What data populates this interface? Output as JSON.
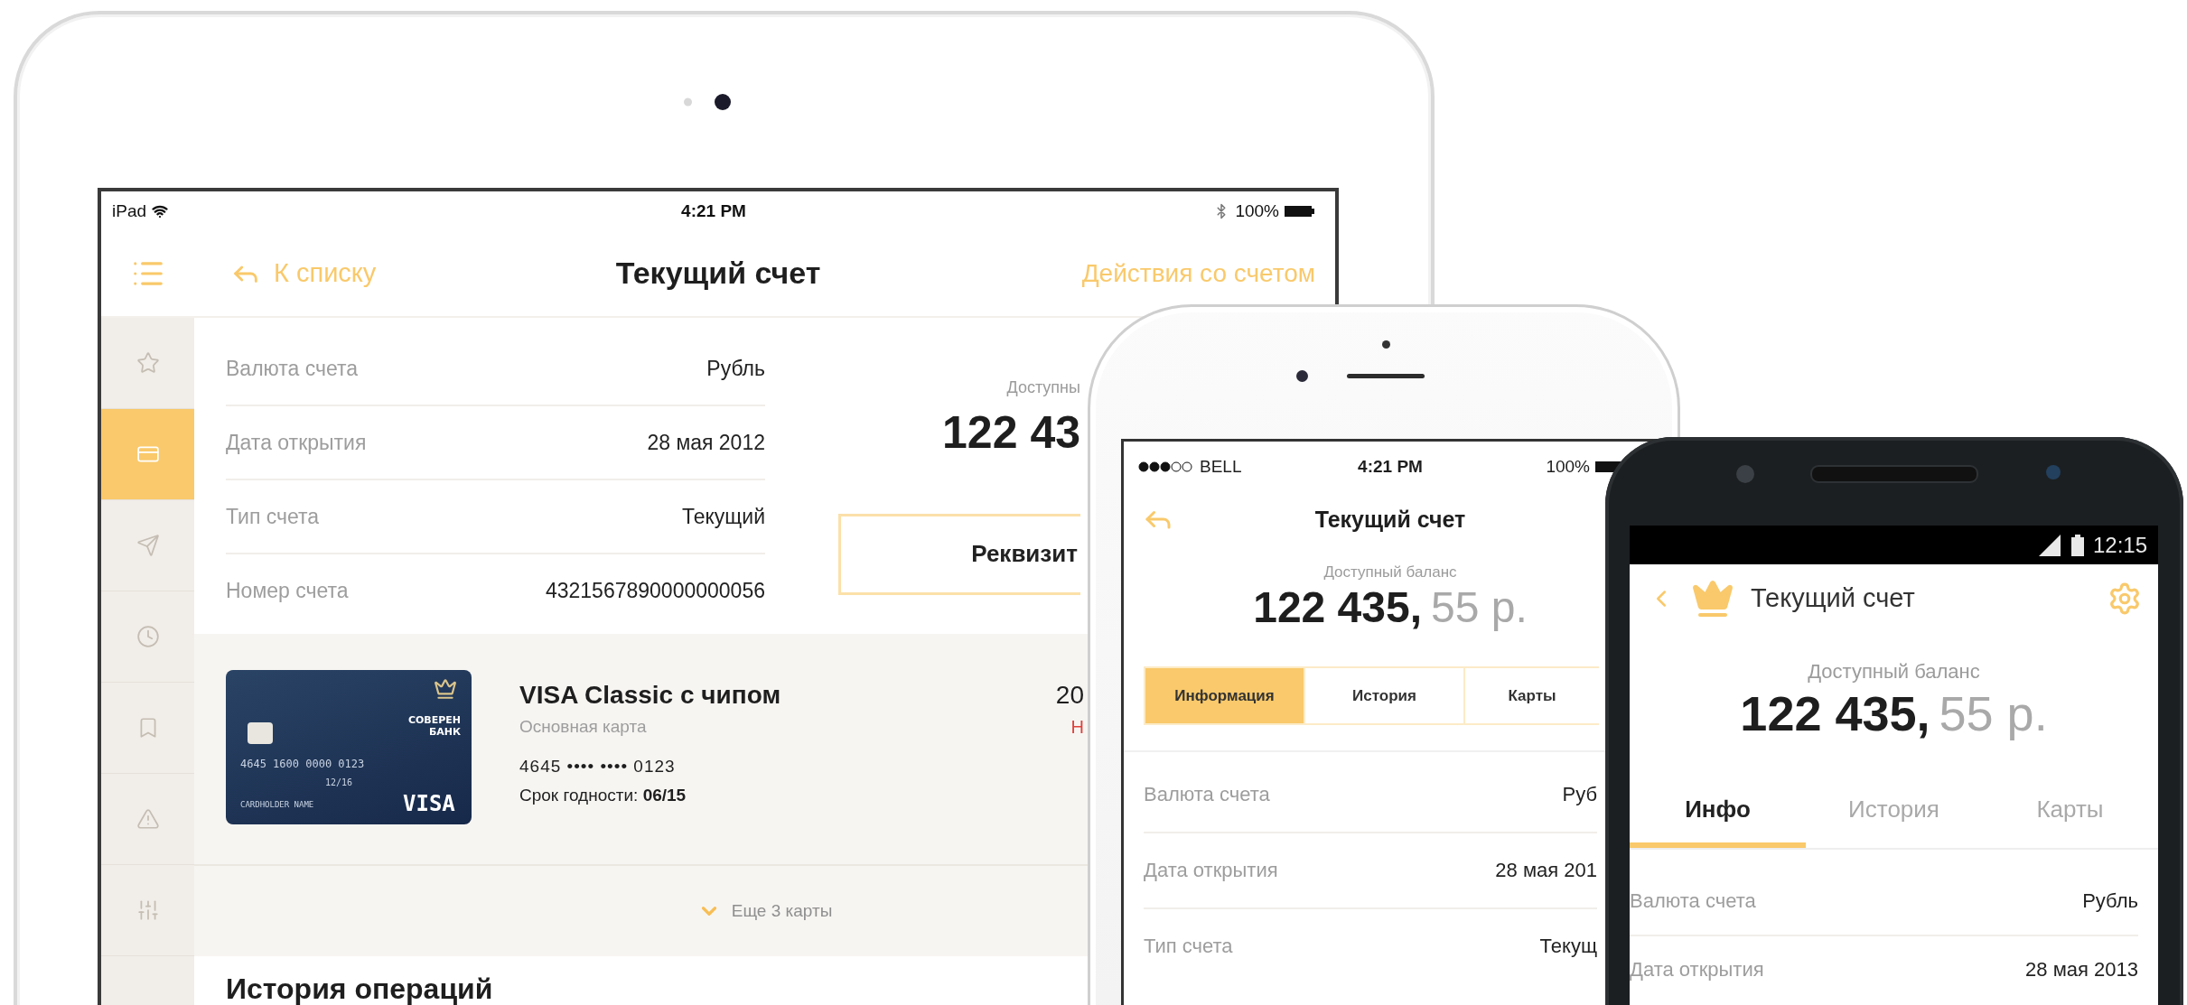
{
  "tablet": {
    "status_bar": {
      "device": "iPad",
      "time": "4:21 PM",
      "battery": "100%"
    },
    "nav": {
      "back": "К списку",
      "title": "Текущий счет",
      "actions": "Действия со счетом"
    },
    "sidebar": [
      {
        "kind": "star",
        "selected": false
      },
      {
        "kind": "card",
        "selected": true
      },
      {
        "kind": "send",
        "selected": false
      },
      {
        "kind": "clock",
        "selected": false
      },
      {
        "kind": "bookmark",
        "selected": false
      },
      {
        "kind": "warning",
        "selected": false
      },
      {
        "kind": "sliders",
        "selected": false
      }
    ],
    "info_rows": [
      {
        "label": "Валюта счета",
        "value": "Рубль"
      },
      {
        "label": "Дата открытия",
        "value": "28 мая 2012"
      },
      {
        "label": "Тип счета",
        "value": "Текущий"
      },
      {
        "label": "Номер счета",
        "value": "4321567890000000056"
      }
    ],
    "balance": {
      "label": "Доступны",
      "amount": "122 43"
    },
    "details_button": "Реквизит",
    "card": {
      "art": {
        "bank": "СОВЕРЕН БАНК",
        "number": "4645 1600 0000 0123",
        "valid": "12/16",
        "holder": "CARDHOLDER NAME",
        "brand": "VISA"
      },
      "name": "VISA Classic с чипом",
      "subtitle": "Основная карта",
      "number": "4645 •••• •••• 0123",
      "expiry": "Срок годности: **06/15**",
      "column_3": "20",
      "column_4": "Н"
    },
    "more_cards": "Еще 3 карты",
    "history_title": "История операций"
  },
  "phone": {
    "status_bar": {
      "carrier": "BELL",
      "time": "4:21 PM",
      "battery": "100%"
    },
    "title": "Текущий счет",
    "balance": {
      "label": "Доступный баланс",
      "whole": "122 435,",
      "fraction": "55 р."
    },
    "tabs": [
      {
        "label": "Информация",
        "selected": true
      },
      {
        "label": "История",
        "selected": false
      },
      {
        "label": "Карты",
        "selected": false
      }
    ],
    "info_rows": [
      {
        "label": "Валюта счета",
        "value": "Руб"
      },
      {
        "label": "Дата открытия",
        "value": "28 мая 201"
      },
      {
        "label": "Тип счета",
        "value": "Текущ"
      }
    ]
  },
  "android": {
    "status_bar": {
      "time": "12:15"
    },
    "title": "Текущий счет",
    "balance": {
      "label": "Доступный баланс",
      "whole": "122 435,",
      "fraction": "55 р."
    },
    "tabs": [
      {
        "label": "Инфо",
        "selected": true
      },
      {
        "label": "История",
        "selected": false
      },
      {
        "label": "Карты",
        "selected": false
      }
    ],
    "info_rows": [
      {
        "label": "Валюта счета",
        "value": "Рубль"
      },
      {
        "label": "Дата открытия",
        "value": "28 мая 2013"
      }
    ]
  }
}
